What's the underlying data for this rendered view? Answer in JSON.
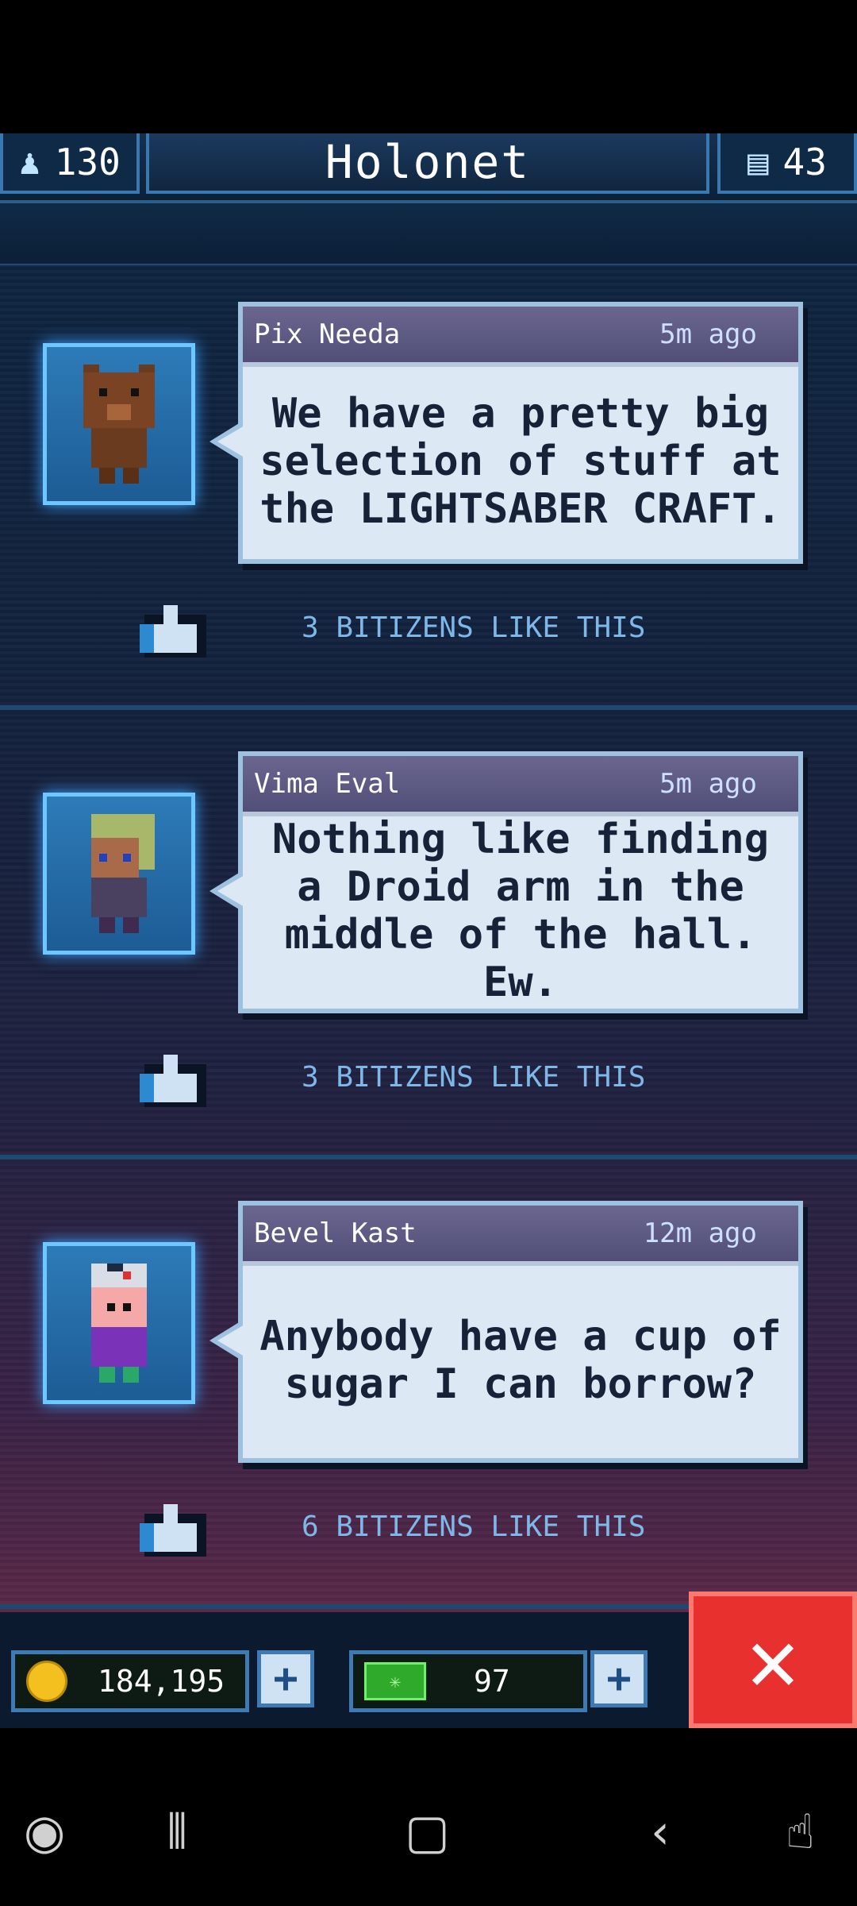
{
  "header": {
    "population": "130",
    "title": "Holonet",
    "floors": "43"
  },
  "posts": [
    {
      "author": "Pix Needa",
      "time": "5m ago",
      "message": "We have a pretty big selection of stuff at the LIGHTSABER CRAFT.",
      "likes": "3 BITIZENS LIKE THIS"
    },
    {
      "author": "Vima Eval",
      "time": "5m ago",
      "message": "Nothing like finding a Droid arm in the middle of the hall. Ew.",
      "likes": "3 BITIZENS LIKE THIS"
    },
    {
      "author": "Bevel Kast",
      "time": "12m ago",
      "message": "Anybody have a cup of sugar I can borrow?",
      "likes": "6 BITIZENS LIKE THIS"
    }
  ],
  "bottom": {
    "coins": "184,195",
    "bux": "97",
    "plus": "+",
    "close": "✕"
  },
  "icons": [
    "person-icon",
    "floors-icon",
    "thumbs-up-icon",
    "coin-icon",
    "bux-icon",
    "close-icon"
  ]
}
